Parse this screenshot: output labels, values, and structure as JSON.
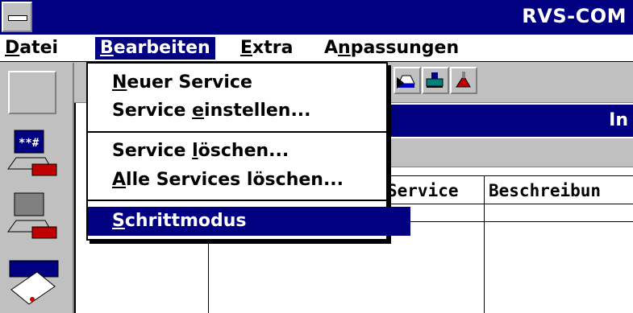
{
  "window": {
    "title": "RVS-COM"
  },
  "menubar": {
    "items": [
      {
        "label": "Datei",
        "key": "D",
        "rest": "atei"
      },
      {
        "label": "Bearbeiten",
        "key": "B",
        "rest": "earbeiten"
      },
      {
        "label": "Extra",
        "key": "E",
        "rest": "xtra"
      },
      {
        "label": "Anpassungen",
        "pre": "A",
        "key": "n",
        "rest": "passungen"
      }
    ]
  },
  "dropdown": {
    "items": [
      {
        "pre": "",
        "key": "N",
        "rest": "euer Service",
        "submenu": true
      },
      {
        "pre": "Service ",
        "key": "e",
        "rest": "instellen..."
      },
      {
        "pre": "Service ",
        "key": "l",
        "rest": "öschen..."
      },
      {
        "pre": "",
        "key": "A",
        "rest": "lle Services löschen..."
      },
      {
        "pre": "",
        "key": "S",
        "rest": "chrittmodus",
        "selected": true
      }
    ]
  },
  "inner": {
    "title_fragment": "In",
    "columns": [
      "Service",
      "Beschreibun"
    ]
  },
  "colors": {
    "titlebar": "#000080",
    "face": "#c0c0c0",
    "highlight": "#000080"
  }
}
